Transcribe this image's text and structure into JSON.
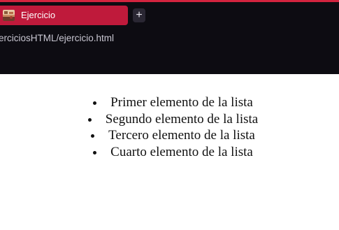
{
  "browser": {
    "tab_title": "Ejercicio",
    "new_tab_symbol": "+",
    "url": "erciciosHTML/ejercicio.html",
    "accent_color": "#bf1a3b",
    "chrome_color": "#0d0c12",
    "favicon": "picture-icon"
  },
  "page": {
    "list_items": [
      "Primer elemento de la lista",
      "Segundo elemento de la lista",
      "Tercero elemento de la lista",
      "Cuarto elemento de la lista"
    ]
  }
}
